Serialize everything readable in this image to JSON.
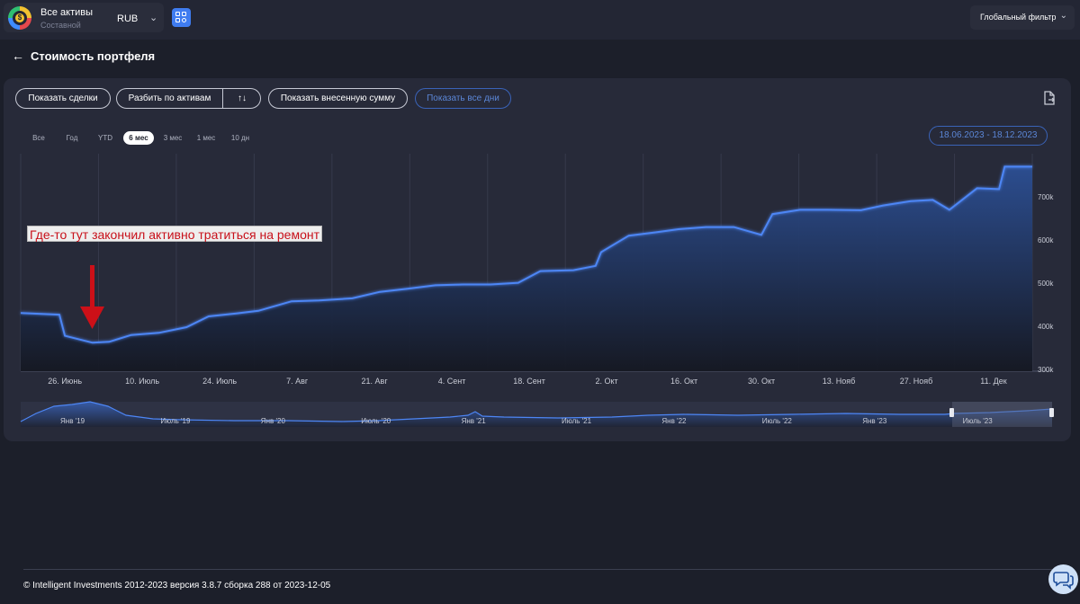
{
  "topbar": {
    "asset_title": "Все активы",
    "asset_subtitle": "Составной",
    "currency": "RUB",
    "global_filter": "Глобальный фильтр"
  },
  "page": {
    "title": "Стоимость портфеля"
  },
  "toolbar": {
    "show_trades": "Показать сделки",
    "split_by_assets": "Разбить по активам",
    "show_invested": "Показать внесенную сумму",
    "show_all_days": "Показать все дни"
  },
  "ranges": {
    "items": [
      "Все",
      "Год",
      "YTD",
      "6 мес",
      "3 мес",
      "1 мес",
      "10 дн"
    ],
    "selected": "6 мес"
  },
  "date_range": "18.06.2023 - 18.12.2023",
  "annotation": "Где-то тут закончил активно тратиться на ремонт",
  "colors": {
    "line": "#3f7cf0",
    "annotation_text": "#c8101a",
    "arrow": "#cc1018",
    "accent_blue": "#3f7cf0"
  },
  "chart_data": {
    "type": "area",
    "title": "",
    "xlabel": "",
    "ylabel": "",
    "x_tick_labels": [
      "26. Июнь",
      "10. Июль",
      "24. Июль",
      "7. Авг",
      "21. Авг",
      "4. Сент",
      "18. Сент",
      "2. Окт",
      "16. Окт",
      "30. Окт",
      "13. Нояб",
      "27. Нояб",
      "11. Дек"
    ],
    "y_tick_labels": [
      "300k",
      "400k",
      "500k",
      "600k",
      "700k"
    ],
    "ylim": [
      296000,
      800000
    ],
    "xlim": [
      "2023-06-18",
      "2023-12-18"
    ],
    "grid": true,
    "legend": "none",
    "x": [
      "2023-06-18",
      "2023-06-25",
      "2023-06-26",
      "2023-07-01",
      "2023-07-04",
      "2023-07-08",
      "2023-07-13",
      "2023-07-18",
      "2023-07-22",
      "2023-07-27",
      "2023-07-31",
      "2023-08-06",
      "2023-08-11",
      "2023-08-17",
      "2023-08-22",
      "2023-08-27",
      "2023-09-01",
      "2023-09-06",
      "2023-09-11",
      "2023-09-16",
      "2023-09-20",
      "2023-09-26",
      "2023-09-30",
      "2023-10-01",
      "2023-10-06",
      "2023-10-11",
      "2023-10-15",
      "2023-10-20",
      "2023-10-25",
      "2023-10-30",
      "2023-11-01",
      "2023-11-06",
      "2023-11-11",
      "2023-11-17",
      "2023-11-21",
      "2023-11-26",
      "2023-11-30",
      "2023-12-03",
      "2023-12-08",
      "2023-12-12",
      "2023-12-13",
      "2023-12-18"
    ],
    "values": [
      431000,
      427000,
      378000,
      362000,
      364000,
      380000,
      385000,
      398000,
      423000,
      430000,
      436000,
      458000,
      460000,
      465000,
      480000,
      487000,
      495000,
      497000,
      497000,
      501000,
      528000,
      530000,
      540000,
      572000,
      610000,
      618000,
      625000,
      630000,
      630000,
      612000,
      660000,
      670000,
      670000,
      669000,
      680000,
      690000,
      693000,
      670000,
      720000,
      718000,
      770000,
      770000
    ],
    "navigator": {
      "tick_labels": [
        "Янв '19",
        "Июль '19",
        "Янв '20",
        "Июль '20",
        "Янв '21",
        "Июль '21",
        "Янв '22",
        "Июль '22",
        "Янв '23",
        "Июль '23"
      ],
      "selected_window": [
        "2023-06-18",
        "2023-12-18"
      ]
    }
  },
  "footer": {
    "text": "© Intelligent Investments 2012-2023 версия 3.8.7 сборка 288 от 2023-12-05"
  }
}
